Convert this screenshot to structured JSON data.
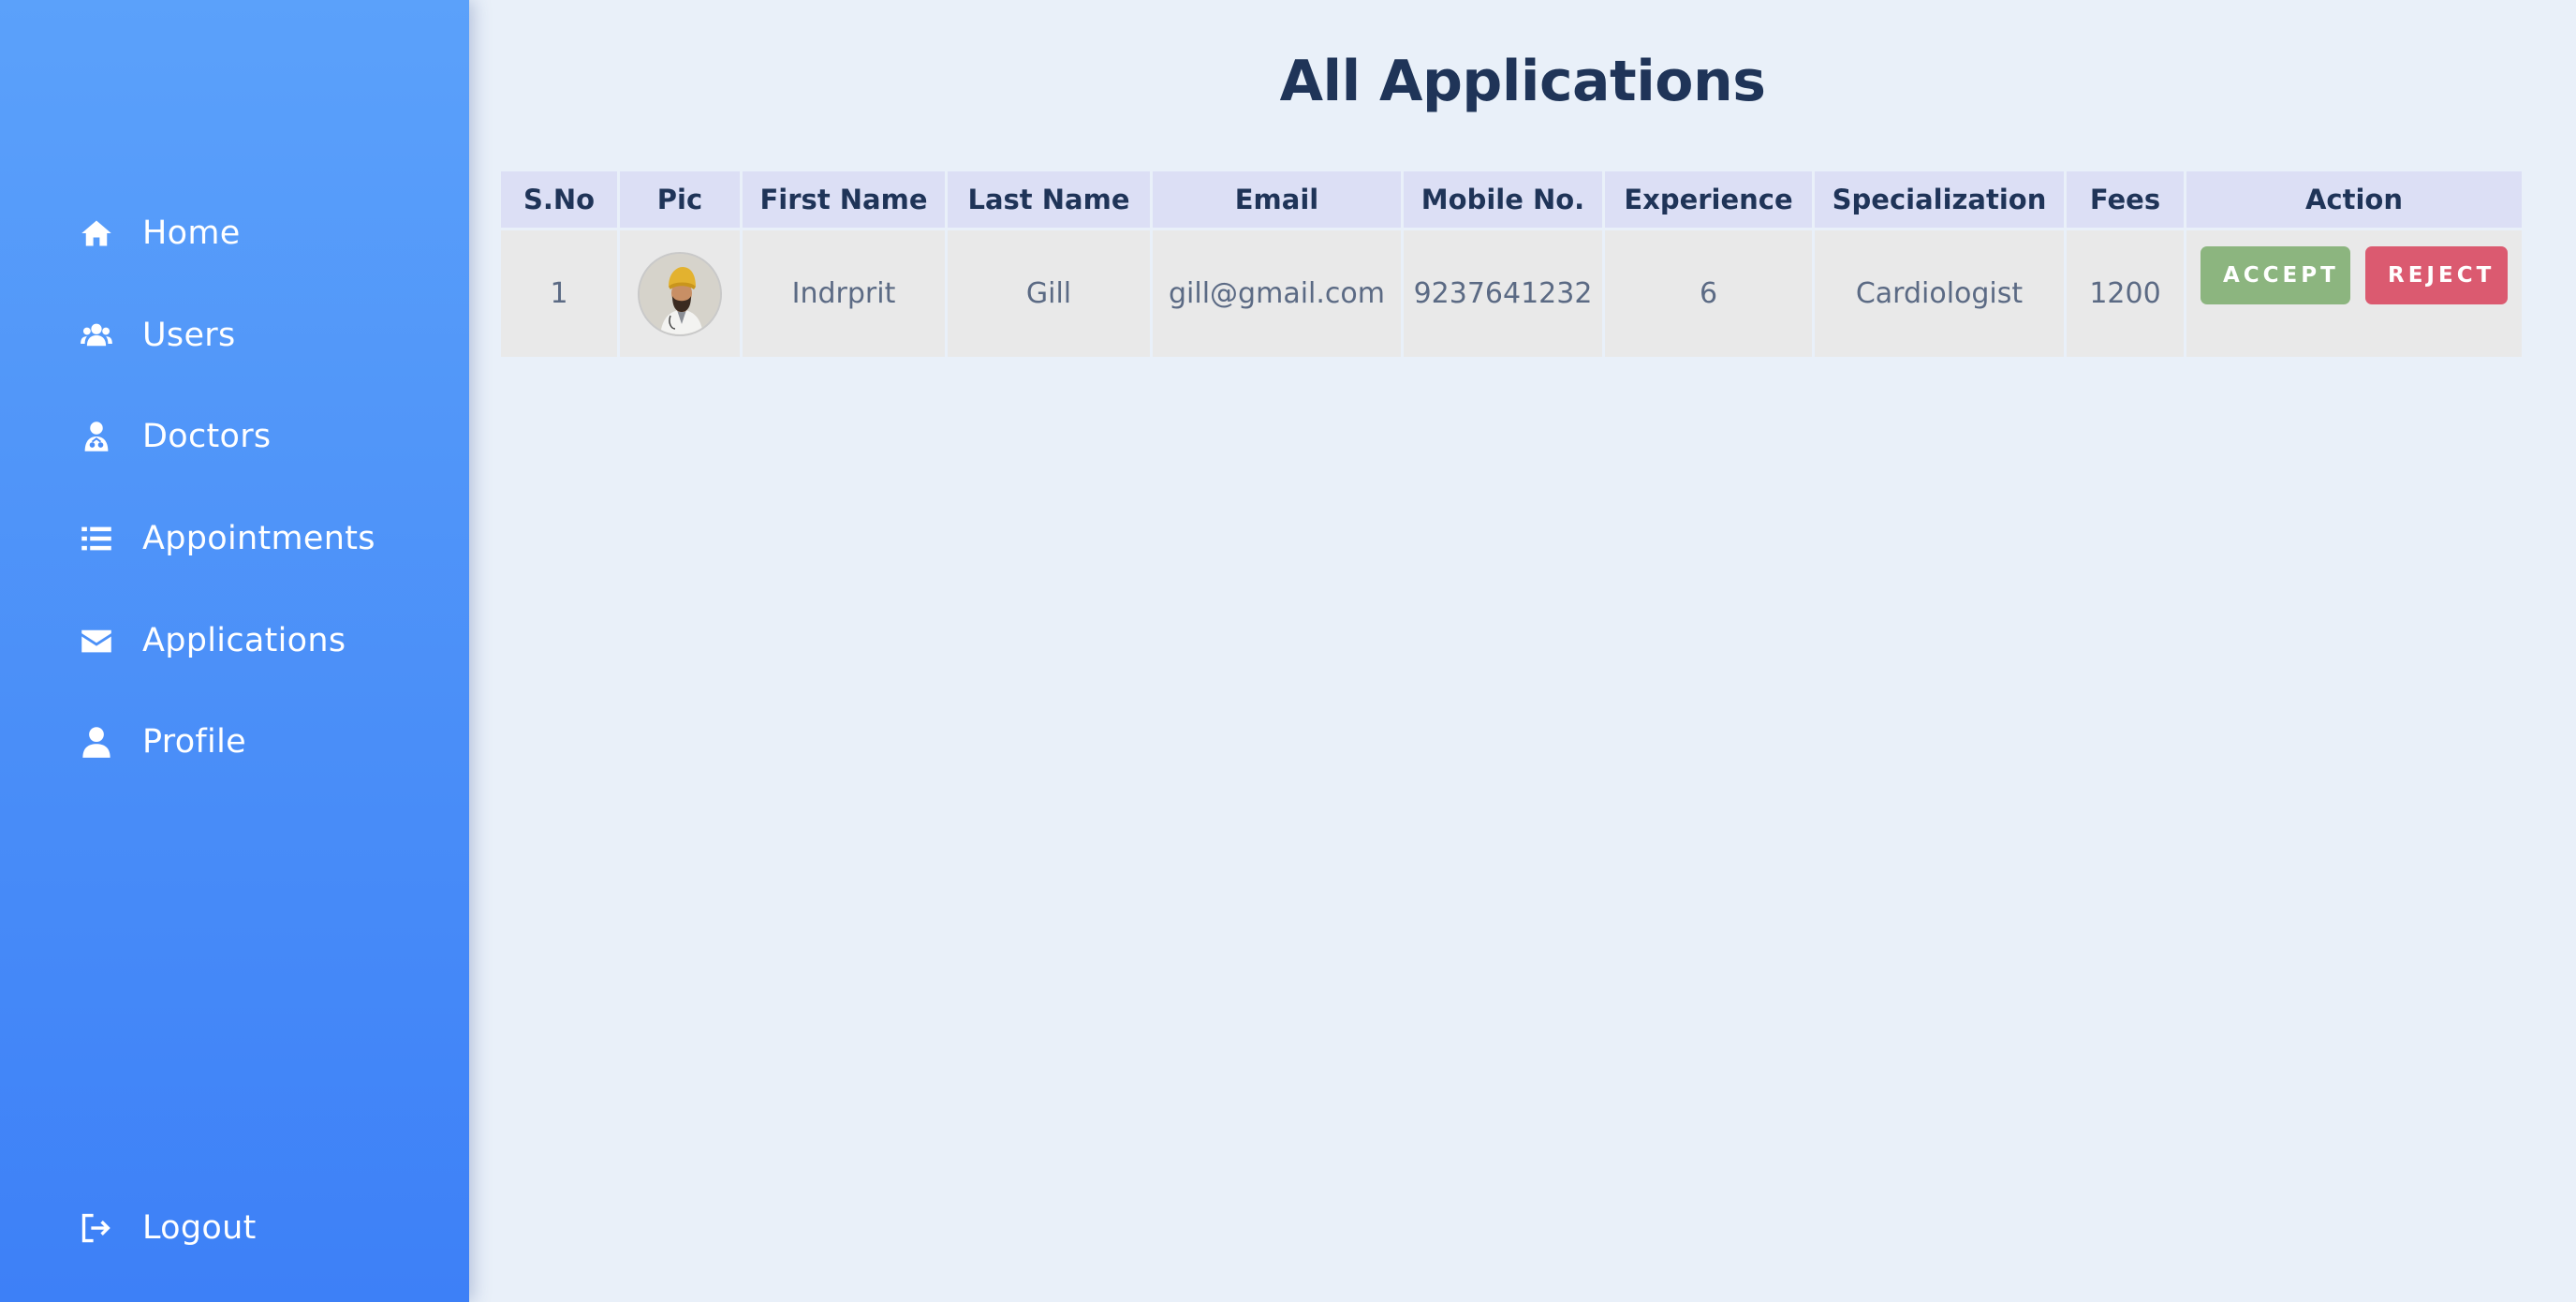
{
  "sidebar": {
    "items": [
      {
        "label": "Home",
        "icon": "home-icon"
      },
      {
        "label": "Users",
        "icon": "users-icon"
      },
      {
        "label": "Doctors",
        "icon": "doctor-icon"
      },
      {
        "label": "Appointments",
        "icon": "list-icon"
      },
      {
        "label": "Applications",
        "icon": "envelope-icon"
      },
      {
        "label": "Profile",
        "icon": "user-icon"
      }
    ],
    "logout": {
      "label": "Logout",
      "icon": "logout-icon"
    }
  },
  "main": {
    "title": "All Applications",
    "table": {
      "headers": [
        "S.No",
        "Pic",
        "First Name",
        "Last Name",
        "Email",
        "Mobile No.",
        "Experience",
        "Specialization",
        "Fees",
        "Action"
      ],
      "rows": [
        {
          "sno": "1",
          "first_name": "Indrprit",
          "last_name": "Gill",
          "email": "gill@gmail.com",
          "mobile": "9237641232",
          "experience": "6",
          "specialization": "Cardiologist",
          "fees": "1200",
          "accept_label": "ACCEPT",
          "reject_label": "REJECT"
        }
      ]
    }
  },
  "colors": {
    "sidebar_top": "#5ba1fa",
    "sidebar_bottom": "#3d80f7",
    "background": "#e9f0f9",
    "title": "#1f3458",
    "accept": "#8cb57f",
    "reject": "#db5a70"
  }
}
